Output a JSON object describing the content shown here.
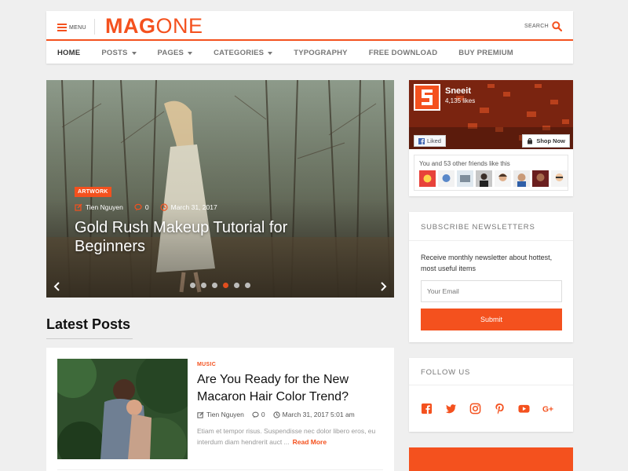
{
  "header": {
    "menu_label": "MENU",
    "logo_part1": "MAG",
    "logo_part2": "ONE",
    "search_label": "SEARCH"
  },
  "nav": {
    "items": [
      {
        "label": "HOME",
        "dropdown": false,
        "active": true
      },
      {
        "label": "POSTS",
        "dropdown": true
      },
      {
        "label": "PAGES",
        "dropdown": true
      },
      {
        "label": "CATEGORIES",
        "dropdown": true
      },
      {
        "label": "TYPOGRAPHY",
        "dropdown": false
      },
      {
        "label": "FREE DOWNLOAD",
        "dropdown": false
      },
      {
        "label": "BUY PREMIUM",
        "dropdown": false
      }
    ]
  },
  "hero": {
    "category": "ARTWORK",
    "author": "Tien Nguyen",
    "comments": "0",
    "date": "March 31, 2017",
    "title": "Gold Rush Makeup Tutorial for Beginners",
    "slide_count": 6,
    "active_slide": 3
  },
  "latest": {
    "heading": "Latest Posts",
    "posts": [
      {
        "category": "MUSIC",
        "title": "Are You Ready for the New Macaron Hair Color Trend?",
        "author": "Tien Nguyen",
        "comments": "0",
        "date": "March 31, 2017 5:01 am",
        "excerpt": "Etiam et tempor risus. Suspendisse nec dolor libero eros, eu interdum diam hendrerit auct ...",
        "read_more": "Read More"
      }
    ]
  },
  "facebook": {
    "page_name": "Sneeit",
    "likes": "4,135 likes",
    "liked_label": "Liked",
    "shop_label": "Shop Now",
    "friends_text": "You and 53 other friends like this"
  },
  "newsletter": {
    "title": "SUBSCRIBE NEWSLETTERS",
    "text": "Receive monthly newsletter about hottest, most useful items",
    "placeholder": "Your Email",
    "submit": "Submit"
  },
  "follow": {
    "title": "FOLLOW US",
    "icons": [
      "facebook-icon",
      "twitter-icon",
      "instagram-icon",
      "pinterest-icon",
      "youtube-icon",
      "google-plus-icon"
    ]
  },
  "colors": {
    "accent": "#f4511e",
    "background": "#efefef"
  }
}
